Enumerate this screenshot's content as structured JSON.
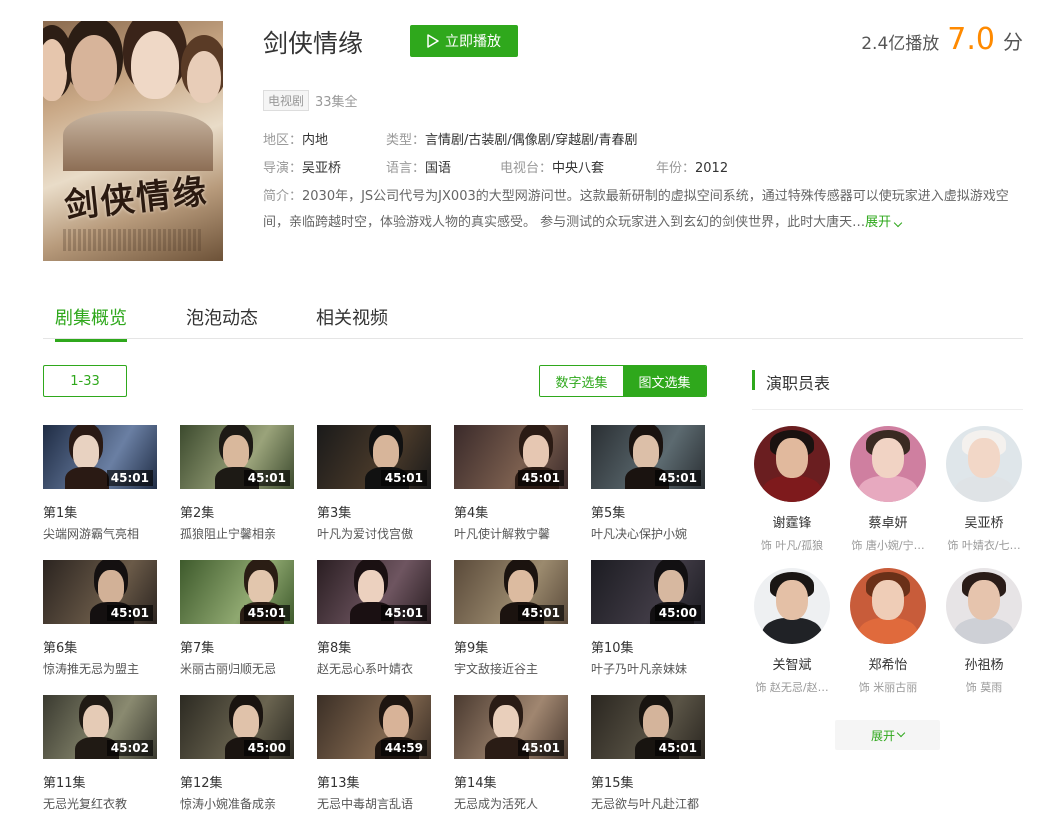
{
  "header": {
    "title": "剑侠情缘",
    "play_label": "立即播放",
    "plays": "2.4亿播放",
    "score": "7.0",
    "score_unit": "分",
    "badge": "电视剧",
    "episodes_total": "33集全",
    "poster_text": "剑侠情缘"
  },
  "meta": {
    "region_k": "地区：",
    "region_v": "内地",
    "genre_k": "类型：",
    "genre_v": "言情剧/古装剧/偶像剧/穿越剧/青春剧",
    "director_k": "导演：",
    "director_v": "吴亚桥",
    "lang_k": "语言：",
    "lang_v": "国语",
    "tv_k": "电视台：",
    "tv_v": "中央八套",
    "year_k": "年份：",
    "year_v": "2012",
    "desc_k": "简介：",
    "desc_v": "2030年，JS公司代号为JX003的大型网游问世。这款最新研制的虚拟空间系统，通过特殊传感器可以使玩家进入虚拟游戏空间，亲临跨越时空，体验游戏人物的真实感受。 参与测试的众玩家进入到玄幻的剑侠世界，此时大唐天…",
    "desc_more": "展开"
  },
  "tabs": [
    "剧集概览",
    "泡泡动态",
    "相关视频"
  ],
  "range_label": "1-33",
  "toggle": {
    "numeric": "数字选集",
    "visual": "图文选集"
  },
  "episodes": [
    {
      "num": "第1集",
      "title": "尖端网游霸气亮相",
      "dur": "45:01"
    },
    {
      "num": "第2集",
      "title": "孤狼阻止宁馨相亲",
      "dur": "45:01"
    },
    {
      "num": "第3集",
      "title": "叶凡为爱讨伐宫傲",
      "dur": "45:01"
    },
    {
      "num": "第4集",
      "title": "叶凡使计解救宁馨",
      "dur": "45:01"
    },
    {
      "num": "第5集",
      "title": "叶凡决心保护小婉",
      "dur": "45:01"
    },
    {
      "num": "第6集",
      "title": "惊涛推无忌为盟主",
      "dur": "45:01"
    },
    {
      "num": "第7集",
      "title": "米丽古丽归顺无忌",
      "dur": "45:01"
    },
    {
      "num": "第8集",
      "title": "赵无忌心系叶婧衣",
      "dur": "45:01"
    },
    {
      "num": "第9集",
      "title": "宇文敌接近谷主",
      "dur": "45:01"
    },
    {
      "num": "第10集",
      "title": "叶子乃叶凡亲妹妹",
      "dur": "45:00"
    },
    {
      "num": "第11集",
      "title": "无忌光复红衣教",
      "dur": "45:02"
    },
    {
      "num": "第12集",
      "title": "惊涛小婉准备成亲",
      "dur": "45:00"
    },
    {
      "num": "第13集",
      "title": "无忌中毒胡言乱语",
      "dur": "44:59"
    },
    {
      "num": "第14集",
      "title": "无忌成为活死人",
      "dur": "45:01"
    },
    {
      "num": "第15集",
      "title": "无忌欲与叶凡赴江都",
      "dur": "45:01"
    }
  ],
  "cast": {
    "title": "演职员表",
    "people": [
      {
        "name": "谢霆锋",
        "role": "饰  叶凡/孤狼"
      },
      {
        "name": "蔡卓妍",
        "role": "饰  唐小婉/宁…"
      },
      {
        "name": "吴亚桥",
        "role": "饰  叶婧衣/七…"
      },
      {
        "name": "关智斌",
        "role": "饰  赵无忌/赵…"
      },
      {
        "name": "郑希怡",
        "role": "饰  米丽古丽"
      },
      {
        "name": "孙祖杨",
        "role": "饰  莫雨"
      }
    ],
    "expand": "展开"
  },
  "colors": {
    "accent": "#2fa81c",
    "score": "#ff8a00"
  }
}
